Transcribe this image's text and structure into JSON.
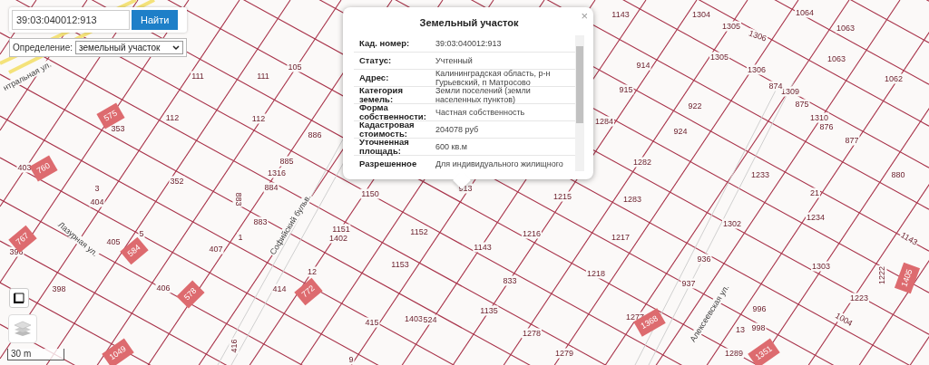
{
  "search": {
    "value": "39:03:040012:913",
    "button": "Найти"
  },
  "definition": {
    "label": "Определение:",
    "value": "земельный участок"
  },
  "popup": {
    "title": "Земельный участок",
    "close": "×",
    "rows": [
      {
        "label": "Кад. номер:",
        "value": "39:03:040012:913"
      },
      {
        "label": "Статус:",
        "value": "Учтенный"
      },
      {
        "label": "Адрес:",
        "value": "Калининградская область, р-н Гурьевский, п Матросово"
      },
      {
        "label": "Категория земель:",
        "value": "Земли поселений (земли населенных пунктов)"
      },
      {
        "label": "Форма собственности:",
        "value": "Частная собственность"
      },
      {
        "label": "Кадастровая стоимость:",
        "value": "204078 руб"
      },
      {
        "label": "Уточненная площадь:",
        "value": "600 кв.м"
      },
      {
        "label": "Разрешенное",
        "value": "Для индивидуального жилищного"
      }
    ]
  },
  "map": {
    "streets": [
      "нтральная ул.",
      "Лазурная ул.",
      "Софийский бульв.",
      "Алексеевская ул."
    ],
    "parcels": [
      {
        "number": "111",
        "kind": "plot"
      },
      {
        "number": "111",
        "kind": "plot"
      },
      {
        "number": "105",
        "kind": "plot"
      },
      {
        "number": "353",
        "kind": "plot"
      },
      {
        "number": "112",
        "kind": "plot"
      },
      {
        "number": "112",
        "kind": "plot"
      },
      {
        "number": "886",
        "kind": "plot"
      },
      {
        "number": "885",
        "kind": "plot"
      },
      {
        "number": "1316",
        "kind": "plot"
      },
      {
        "number": "884",
        "kind": "plot"
      },
      {
        "number": "352",
        "kind": "plot"
      },
      {
        "number": "403",
        "kind": "plot"
      },
      {
        "number": "3",
        "kind": "plot"
      },
      {
        "number": "404",
        "kind": "plot"
      },
      {
        "number": "883",
        "kind": "plot"
      },
      {
        "number": "883",
        "kind": "plot"
      },
      {
        "number": "1",
        "kind": "plot"
      },
      {
        "number": "407",
        "kind": "plot"
      },
      {
        "number": "405",
        "kind": "plot"
      },
      {
        "number": "5",
        "kind": "plot"
      },
      {
        "number": "396",
        "kind": "plot"
      },
      {
        "number": "398",
        "kind": "plot"
      },
      {
        "number": "406",
        "kind": "plot"
      },
      {
        "number": "414",
        "kind": "plot"
      },
      {
        "number": "12",
        "kind": "plot"
      },
      {
        "number": "415",
        "kind": "plot"
      },
      {
        "number": "1403",
        "kind": "plot"
      },
      {
        "number": "524",
        "kind": "plot"
      },
      {
        "number": "1150",
        "kind": "plot"
      },
      {
        "number": "913",
        "kind": "plot"
      },
      {
        "number": "1151",
        "kind": "plot"
      },
      {
        "number": "1402",
        "kind": "plot"
      },
      {
        "number": "1152",
        "kind": "plot"
      },
      {
        "number": "1153",
        "kind": "plot"
      },
      {
        "number": "1143",
        "kind": "plot"
      },
      {
        "number": "833",
        "kind": "plot"
      },
      {
        "number": "1135",
        "kind": "plot"
      },
      {
        "number": "1278",
        "kind": "plot"
      },
      {
        "number": "1215",
        "kind": "plot"
      },
      {
        "number": "1216",
        "kind": "plot"
      },
      {
        "number": "1217",
        "kind": "plot"
      },
      {
        "number": "1218",
        "kind": "plot"
      },
      {
        "number": "1283",
        "kind": "plot"
      },
      {
        "number": "1282",
        "kind": "plot"
      },
      {
        "number": "1284",
        "kind": "plot"
      },
      {
        "number": "915",
        "kind": "plot"
      },
      {
        "number": "914",
        "kind": "plot"
      },
      {
        "number": "922",
        "kind": "plot"
      },
      {
        "number": "924",
        "kind": "plot"
      },
      {
        "number": "1143",
        "kind": "plot"
      },
      {
        "number": "1304",
        "kind": "plot"
      },
      {
        "number": "1305",
        "kind": "plot"
      },
      {
        "number": "1064",
        "kind": "plot"
      },
      {
        "number": "1063",
        "kind": "plot"
      },
      {
        "number": "1306",
        "kind": "plot"
      },
      {
        "number": "1305",
        "kind": "plot"
      },
      {
        "number": "1306",
        "kind": "plot"
      },
      {
        "number": "1063",
        "kind": "plot"
      },
      {
        "number": "1062",
        "kind": "plot"
      },
      {
        "number": "1309",
        "kind": "plot"
      },
      {
        "number": "874",
        "kind": "plot"
      },
      {
        "number": "875",
        "kind": "plot"
      },
      {
        "number": "876",
        "kind": "plot"
      },
      {
        "number": "1310",
        "kind": "plot"
      },
      {
        "number": "877",
        "kind": "plot"
      },
      {
        "number": "1233",
        "kind": "plot"
      },
      {
        "number": "880",
        "kind": "plot"
      },
      {
        "number": "21",
        "kind": "plot"
      },
      {
        "number": "1234",
        "kind": "plot"
      },
      {
        "number": "1302",
        "kind": "plot"
      },
      {
        "number": "1303",
        "kind": "plot"
      },
      {
        "number": "936",
        "kind": "plot"
      },
      {
        "number": "937",
        "kind": "plot"
      },
      {
        "number": "996",
        "kind": "plot"
      },
      {
        "number": "998",
        "kind": "plot"
      },
      {
        "number": "1277",
        "kind": "plot"
      },
      {
        "number": "13",
        "kind": "plot"
      },
      {
        "number": "1289",
        "kind": "plot"
      },
      {
        "number": "1222",
        "kind": "plot"
      },
      {
        "number": "1223",
        "kind": "plot"
      },
      {
        "number": "1004",
        "kind": "plot"
      },
      {
        "number": "1143",
        "kind": "plot"
      },
      {
        "number": "1279",
        "kind": "plot"
      },
      {
        "number": "9",
        "kind": "plot"
      },
      {
        "number": "416",
        "kind": "plot"
      },
      {
        "number": "575",
        "kind": "building"
      },
      {
        "number": "760",
        "kind": "building"
      },
      {
        "number": "767",
        "kind": "building"
      },
      {
        "number": "584",
        "kind": "building"
      },
      {
        "number": "578",
        "kind": "building"
      },
      {
        "number": "772",
        "kind": "building"
      },
      {
        "number": "1368",
        "kind": "building"
      },
      {
        "number": "1351",
        "kind": "building"
      },
      {
        "number": "1405",
        "kind": "building"
      },
      {
        "number": "1049",
        "kind": "building"
      }
    ],
    "scale": "30 m"
  }
}
